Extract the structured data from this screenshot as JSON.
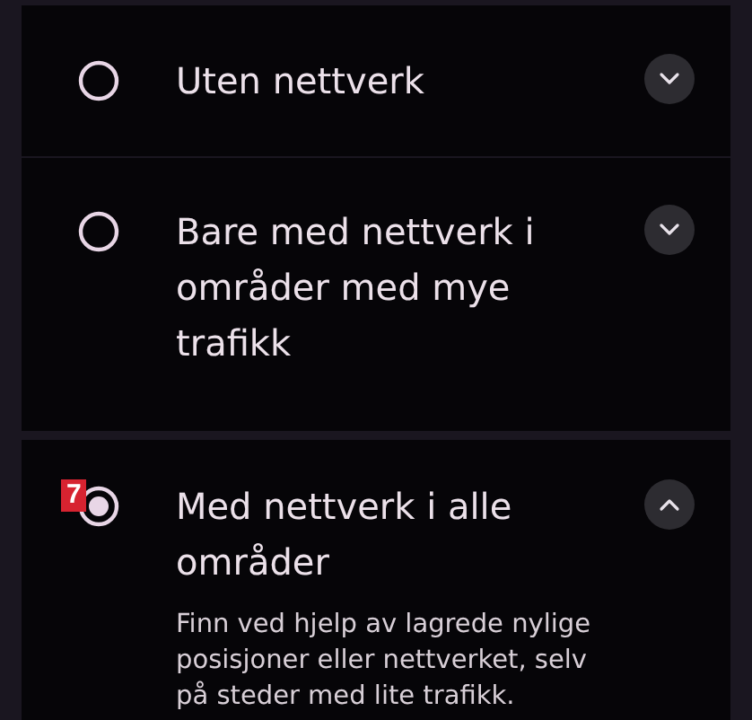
{
  "options": [
    {
      "label": "Uten nettverk",
      "selected": false,
      "expanded": false
    },
    {
      "label": "Bare med nettverk i områder med mye trafikk",
      "selected": false,
      "expanded": false
    },
    {
      "label": "Med nettverk i alle områder",
      "selected": true,
      "expanded": true,
      "description": "Finn ved hjelp av lagrede nylige posisjoner eller nettverket, selv på steder med lite trafikk.",
      "marker": "7"
    }
  ]
}
